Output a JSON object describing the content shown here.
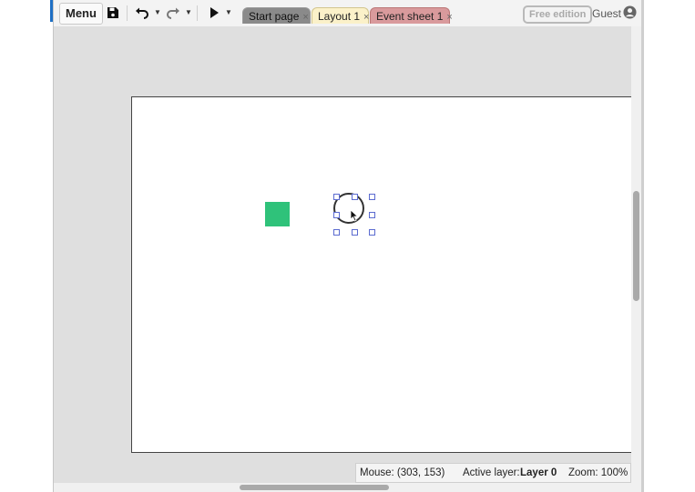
{
  "toolbar": {
    "menu_label": "Menu",
    "icons": [
      "save-icon",
      "undo-icon",
      "redo-icon",
      "play-icon"
    ]
  },
  "tabs": [
    {
      "label": "Start page",
      "close": "×",
      "color": "#8a8a8a"
    },
    {
      "label": "Layout 1",
      "close": "×",
      "color": "#fbf1c9",
      "active": true
    },
    {
      "label": "Event sheet 1",
      "close": "×",
      "color": "#d99a9c"
    }
  ],
  "account": {
    "edition_badge": "Free edition",
    "user_label": "Guest"
  },
  "status": {
    "mouse": "Mouse: (303, 153)",
    "active_layer_label": "Active layer:",
    "active_layer_value": "Layer 0",
    "zoom": "Zoom: 100%"
  },
  "colors": {
    "sprite": "#2fc27a",
    "selection_handle": "#5b6bd0",
    "accent": "#1e6fc4"
  }
}
